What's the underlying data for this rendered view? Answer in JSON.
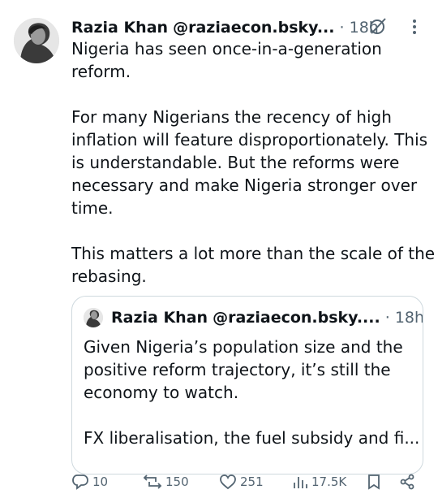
{
  "author": {
    "name": "Razia Khan",
    "handle": "@raziaecon.bsky...",
    "separator": "·",
    "time": "18h"
  },
  "post": {
    "lines": [
      "Nigeria has seen once-in-a-generation",
      "reform.",
      "",
      "For many Nigerians the recency of high",
      "inflation will feature disproportionately. This",
      "is understandable. But the reforms were",
      "necessary and make Nigeria stronger over",
      "time.",
      "",
      "This matters a lot more than the scale of the",
      "rebasing."
    ]
  },
  "quoted": {
    "name": "Razia Khan",
    "handle": "@raziaecon.bsky....",
    "separator": "·",
    "time": "18h",
    "lines": [
      "Given Nigeria’s population size and the",
      "positive reform trajectory, it’s still the",
      "economy to watch.",
      "",
      "FX liberalisation, the fuel subsidy and fi..."
    ]
  },
  "actions": {
    "replies": "10",
    "reposts": "150",
    "likes": "251",
    "views": "17.5K"
  },
  "icons": {
    "grok": "grok-icon",
    "more": "more-dots-icon",
    "reply": "reply-icon",
    "repost": "repost-icon",
    "like": "like-icon",
    "views": "views-icon",
    "bookmark": "bookmark-icon",
    "share": "share-icon"
  },
  "colors": {
    "text": "#0f1419",
    "muted": "#536471",
    "border": "#cfd9de"
  }
}
